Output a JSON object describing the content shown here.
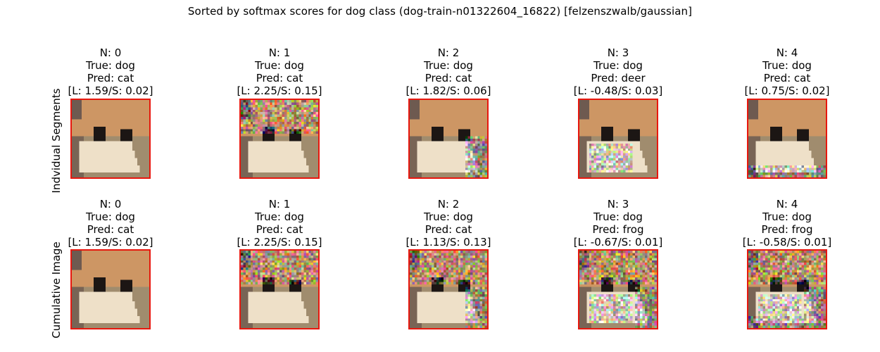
{
  "title": "Sorted by softmax scores for dog class (dog-train-n01322604_16822) [felzenszwalb/gaussian]",
  "rows": [
    {
      "label": "Indvidual Segments",
      "cells": [
        {
          "n": "N: 0",
          "true": "True: dog",
          "pred": "Pred: cat",
          "scores": "[L: 1.59/S: 0.02]",
          "noise": "none"
        },
        {
          "n": "N: 1",
          "true": "True: dog",
          "pred": "Pred: cat",
          "scores": "[L: 2.25/S: 0.15]",
          "noise": "top"
        },
        {
          "n": "N: 2",
          "true": "True: dog",
          "pred": "Pred: cat",
          "scores": "[L: 1.82/S: 0.06]",
          "noise": "right"
        },
        {
          "n": "N: 3",
          "true": "True: dog",
          "pred": "Pred: deer",
          "scores": "[L: -0.48/S: 0.03]",
          "noise": "chest"
        },
        {
          "n": "N: 4",
          "true": "True: dog",
          "pred": "Pred: cat",
          "scores": "[L: 0.75/S: 0.02]",
          "noise": "bottom"
        }
      ]
    },
    {
      "label": "Cumulative Image",
      "cells": [
        {
          "n": "N: 0",
          "true": "True: dog",
          "pred": "Pred: cat",
          "scores": "[L: 1.59/S: 0.02]",
          "noise": "none"
        },
        {
          "n": "N: 1",
          "true": "True: dog",
          "pred": "Pred: cat",
          "scores": "[L: 2.25/S: 0.15]",
          "noise": "top"
        },
        {
          "n": "N: 2",
          "true": "True: dog",
          "pred": "Pred: cat",
          "scores": "[L: 1.13/S: 0.13]",
          "noise": "top+right"
        },
        {
          "n": "N: 3",
          "true": "True: dog",
          "pred": "Pred: frog",
          "scores": "[L: -0.67/S: 0.01]",
          "noise": "top+right+chest"
        },
        {
          "n": "N: 4",
          "true": "True: dog",
          "pred": "Pred: frog",
          "scores": "[L: -0.58/S: 0.01]",
          "noise": "all"
        }
      ]
    }
  ],
  "colors": {
    "frame": "#e8170e"
  }
}
